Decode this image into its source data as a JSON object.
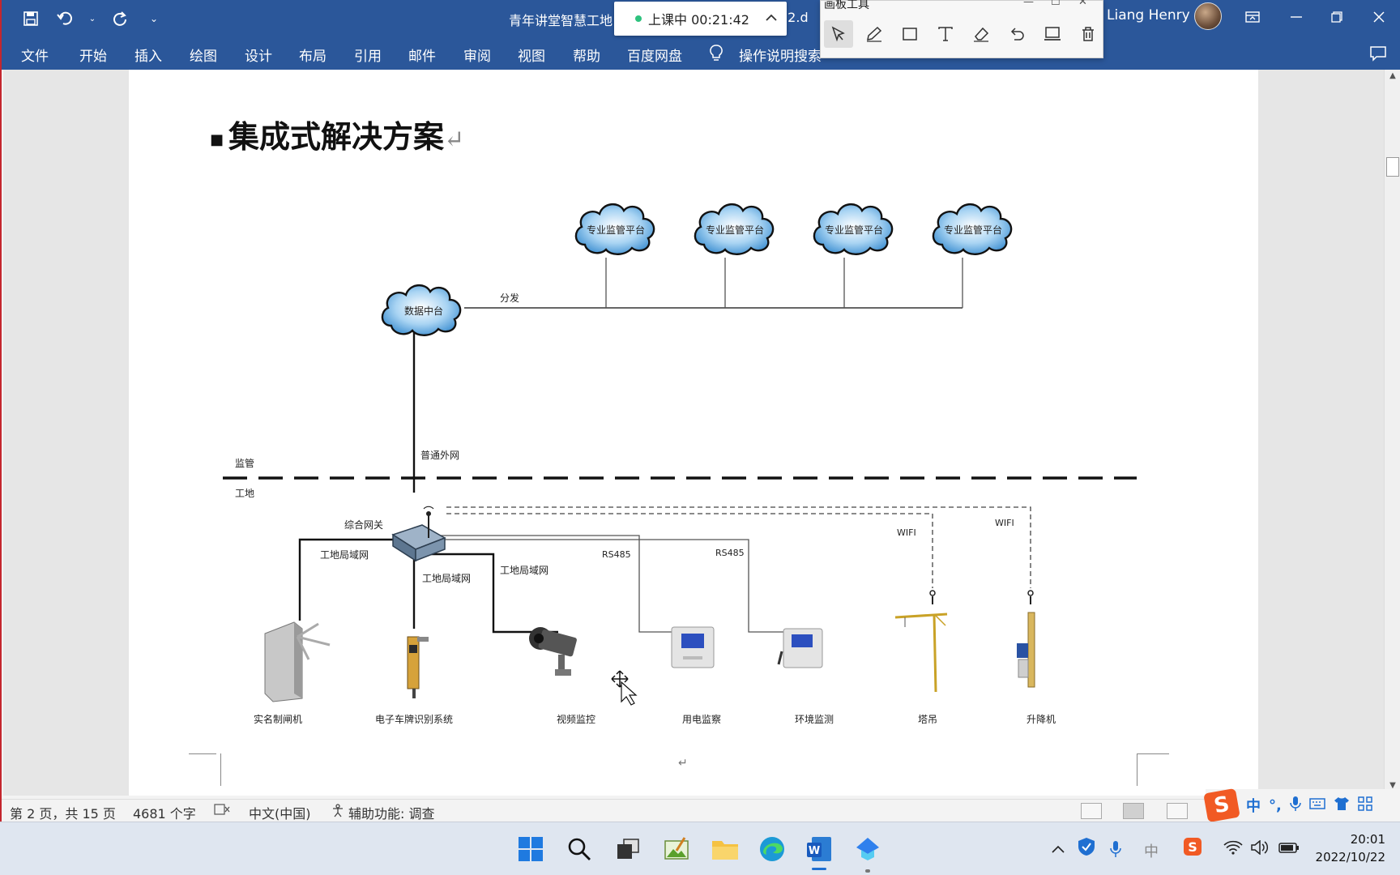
{
  "window": {
    "title": "青年讲堂智慧工地",
    "title_suffix": "22.d",
    "user_name": "Liang Henry"
  },
  "class_timer": {
    "label": "上课中 00:21:42"
  },
  "toolbox": {
    "title": "画板工具"
  },
  "ribbon": {
    "tabs": [
      "文件",
      "开始",
      "插入",
      "绘图",
      "设计",
      "布局",
      "引用",
      "邮件",
      "审阅",
      "视图",
      "帮助",
      "百度网盘"
    ],
    "tell_me": "操作说明搜索"
  },
  "document": {
    "heading": "集成式解决方案",
    "para_mark": "↵"
  },
  "diagram": {
    "platforms": [
      "专业监管平台",
      "专业监管平台",
      "专业监管平台",
      "专业监管平台"
    ],
    "data_center": "数据中台",
    "distribute": "分发",
    "external_net": "普通外网",
    "zone_supervision": "监管",
    "zone_site": "工地",
    "gateway": "综合网关",
    "lan1": "工地局域网",
    "lan2": "工地局域网",
    "lan3": "工地局域网",
    "rs485_1": "RS485",
    "rs485_2": "RS485",
    "wifi_1": "WIFI",
    "wifi_2": "WIFI",
    "devices": [
      "实名制闸机",
      "电子车牌识别系统",
      "视频监控",
      "用电监察",
      "环境监测",
      "塔吊",
      "升降机"
    ]
  },
  "statusbar": {
    "page": "第 2 页，共 15 页",
    "words": "4681 个字",
    "language": "中文(中国)",
    "accessibility": "辅助功能: 调查"
  },
  "ime": {
    "mode": "中",
    "punct": "°,"
  },
  "taskbar": {
    "time": "20:01",
    "date": "2022/10/22",
    "tray_ime": "中"
  }
}
